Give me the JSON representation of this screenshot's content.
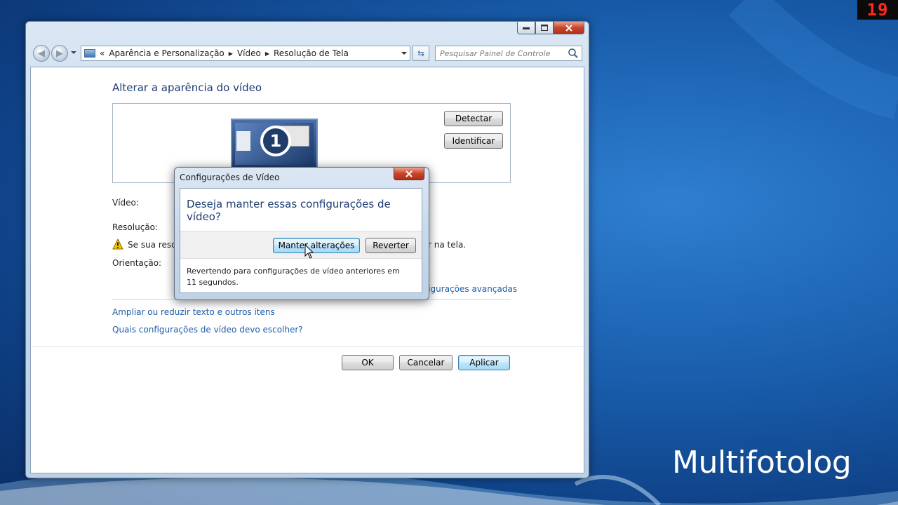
{
  "overlay": {
    "counter": "19",
    "watermark": "Multifotolog"
  },
  "window": {
    "breadcrumb": [
      "Aparência e Personalização",
      "Vídeo",
      "Resolução de Tela"
    ],
    "breadcrumb_prefix": "«",
    "search_placeholder": "Pesquisar Painel de Controle",
    "page_title": "Alterar a aparência do vídeo",
    "monitor_number": "1",
    "detect_label": "Detectar",
    "identify_label": "Identificar",
    "video_label": "Vídeo:",
    "resolution_label": "Resolução:",
    "warning_text_start": "Se sua resolu",
    "warning_text_end": "r na tela.",
    "orientation_label": "Orientação:",
    "advanced_link": "figurações avançadas",
    "link_text_size": "Ampliar ou reduzir texto e outros itens",
    "link_which_settings": "Quais configurações de vídeo devo escolher?",
    "ok_label": "OK",
    "cancel_label": "Cancelar",
    "apply_label": "Aplicar"
  },
  "dialog": {
    "title": "Configurações de Vídeo",
    "question": "Deseja manter essas configurações de vídeo?",
    "keep_label": "Manter alterações",
    "revert_label": "Reverter",
    "message": "Revertendo para configurações de vídeo anteriores em 11 segundos."
  },
  "colors": {
    "accent_title": "#1e3c73",
    "link": "#1f5ea8",
    "counter": "#ff2a1a"
  }
}
